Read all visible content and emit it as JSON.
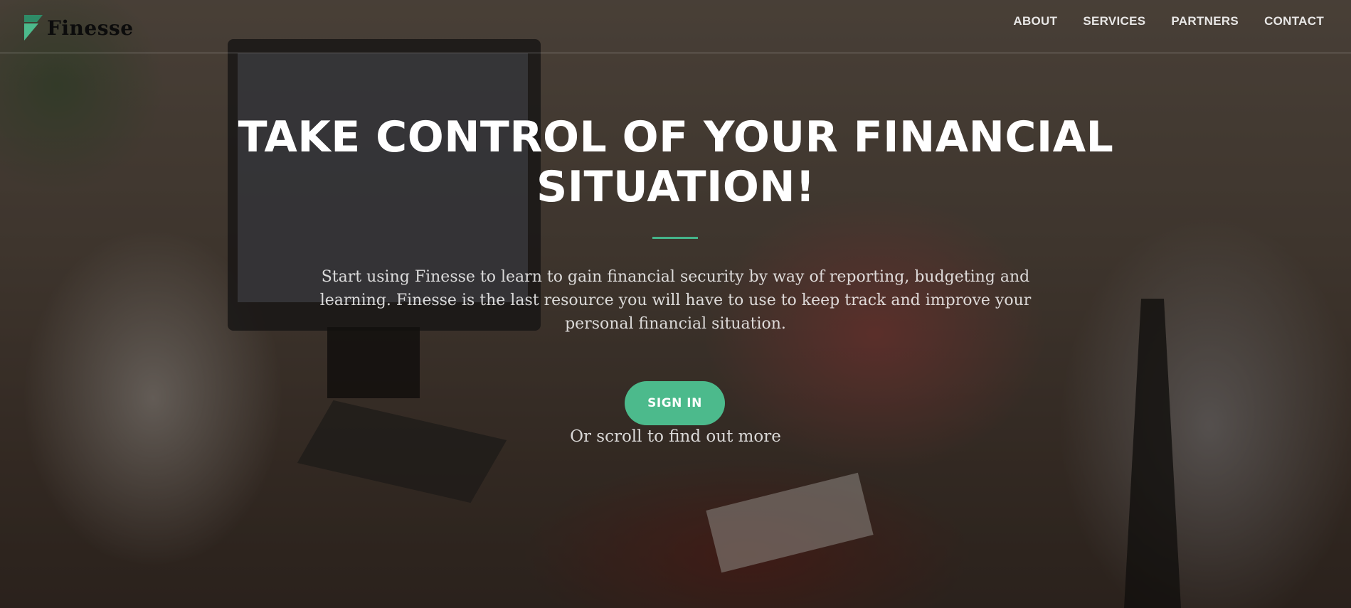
{
  "brand": {
    "name": "Finesse",
    "logo_icon": "finesse-flag-logo",
    "logo_colors": [
      "#2e8b67",
      "#4cba8c"
    ]
  },
  "nav": {
    "items": [
      {
        "label": "ABOUT"
      },
      {
        "label": "SERVICES"
      },
      {
        "label": "PARTNERS"
      },
      {
        "label": "CONTACT"
      }
    ]
  },
  "hero": {
    "headline": "TAKE CONTROL OF YOUR FINANCIAL SITUATION!",
    "lead": "Start using Finesse to learn to gain financial security by way of reporting, budgeting and learning. Finesse is the last resource you will have to use to keep track and improve your personal financial situation.",
    "cta_label": "SIGN IN",
    "scroll_hint": "Or scroll to find out more"
  },
  "colors": {
    "accent": "#4cba8c",
    "text": "#ffffff"
  }
}
